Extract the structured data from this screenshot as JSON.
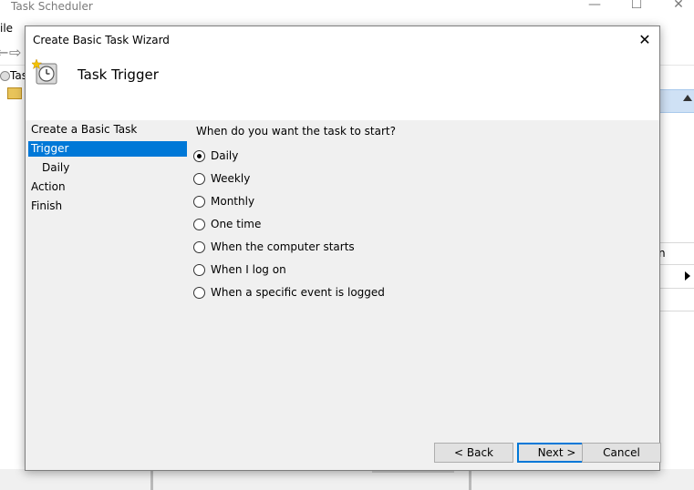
{
  "background_window": {
    "title": "Task Scheduler",
    "controls": [
      "—",
      "☐",
      "✕"
    ],
    "menu_fragment": "ile",
    "tree_fragment": "Tas",
    "right_pane_fragment": "n"
  },
  "dialog": {
    "title": "Create Basic Task Wizard",
    "close_glyph": "✕",
    "header_title": "Task Trigger",
    "header_icon": "clock-icon",
    "steps": [
      {
        "label": "Create a Basic Task",
        "selected": false,
        "indent": false
      },
      {
        "label": "Trigger",
        "selected": true,
        "indent": false
      },
      {
        "label": "Daily",
        "selected": false,
        "indent": true
      },
      {
        "label": "Action",
        "selected": false,
        "indent": false
      },
      {
        "label": "Finish",
        "selected": false,
        "indent": false
      }
    ],
    "question": "When do you want the task to start?",
    "options": [
      {
        "label": "Daily",
        "checked": true
      },
      {
        "label": "Weekly",
        "checked": false
      },
      {
        "label": "Monthly",
        "checked": false
      },
      {
        "label": "One time",
        "checked": false
      },
      {
        "label": "When the computer starts",
        "checked": false
      },
      {
        "label": "When I log on",
        "checked": false
      },
      {
        "label": "When a specific event is logged",
        "checked": false
      }
    ],
    "buttons": {
      "back": "< Back",
      "next": "Next >",
      "cancel": "Cancel"
    },
    "accent_color": "#0078d7"
  }
}
